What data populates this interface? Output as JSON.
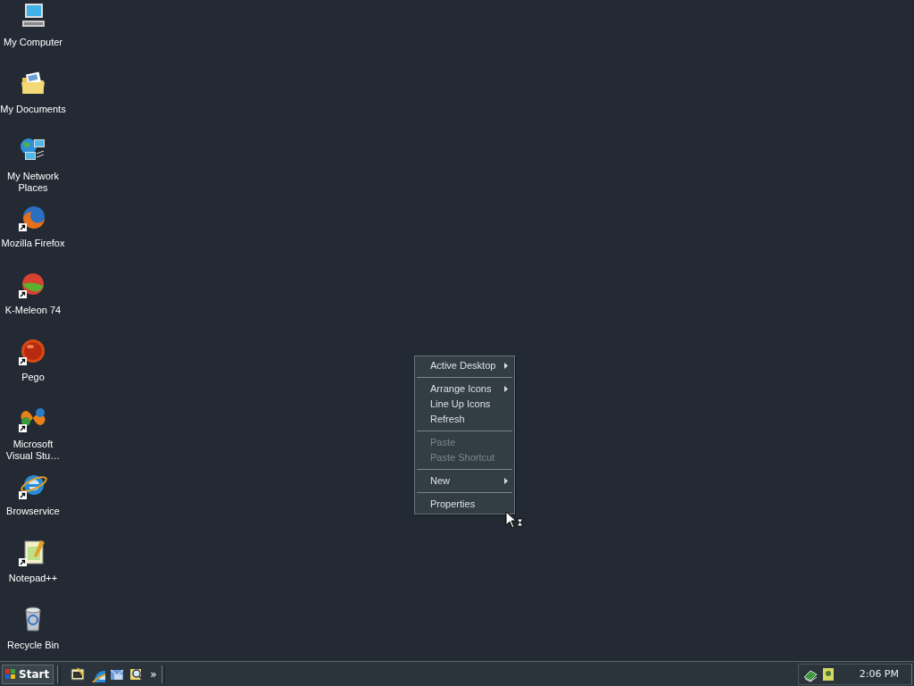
{
  "desktop_icons": [
    {
      "label": "My Computer",
      "kind": "computer",
      "shortcut": false
    },
    {
      "label": "My Documents",
      "kind": "documents",
      "shortcut": false
    },
    {
      "label": "My Network Places",
      "kind": "network",
      "shortcut": false
    },
    {
      "label": "Mozilla Firefox",
      "kind": "firefox",
      "shortcut": true
    },
    {
      "label": "K-Meleon 74",
      "kind": "kmeleon",
      "shortcut": true
    },
    {
      "label": "Pego",
      "kind": "pego",
      "shortcut": true
    },
    {
      "label": "Microsoft Visual Stu…",
      "kind": "visualstudio",
      "shortcut": true
    },
    {
      "label": "Browservice",
      "kind": "ie",
      "shortcut": true
    },
    {
      "label": "Notepad++",
      "kind": "notepad",
      "shortcut": true
    },
    {
      "label": "Recycle Bin",
      "kind": "recycle",
      "shortcut": false
    }
  ],
  "context_menu": [
    {
      "kind": "item",
      "label": "Active Desktop",
      "disabled": false,
      "submenu": true
    },
    {
      "kind": "separator"
    },
    {
      "kind": "item",
      "label": "Arrange Icons",
      "disabled": false,
      "submenu": true
    },
    {
      "kind": "item",
      "label": "Line Up Icons",
      "disabled": false,
      "submenu": false
    },
    {
      "kind": "item",
      "label": "Refresh",
      "disabled": false,
      "submenu": false
    },
    {
      "kind": "separator"
    },
    {
      "kind": "item",
      "label": "Paste",
      "disabled": true,
      "submenu": false
    },
    {
      "kind": "item",
      "label": "Paste Shortcut",
      "disabled": true,
      "submenu": false
    },
    {
      "kind": "separator"
    },
    {
      "kind": "item",
      "label": "New",
      "disabled": false,
      "submenu": true
    },
    {
      "kind": "separator"
    },
    {
      "kind": "item",
      "label": "Properties",
      "disabled": false,
      "submenu": false
    }
  ],
  "taskbar": {
    "start_label": "Start",
    "quick_launch": [
      {
        "kind": "showdesktop"
      },
      {
        "kind": "ie"
      },
      {
        "kind": "outlook"
      },
      {
        "kind": "search"
      }
    ],
    "overflow": "»",
    "tray_icons": [
      {
        "kind": "network"
      },
      {
        "kind": "app"
      }
    ],
    "clock": "2:06 PM"
  }
}
